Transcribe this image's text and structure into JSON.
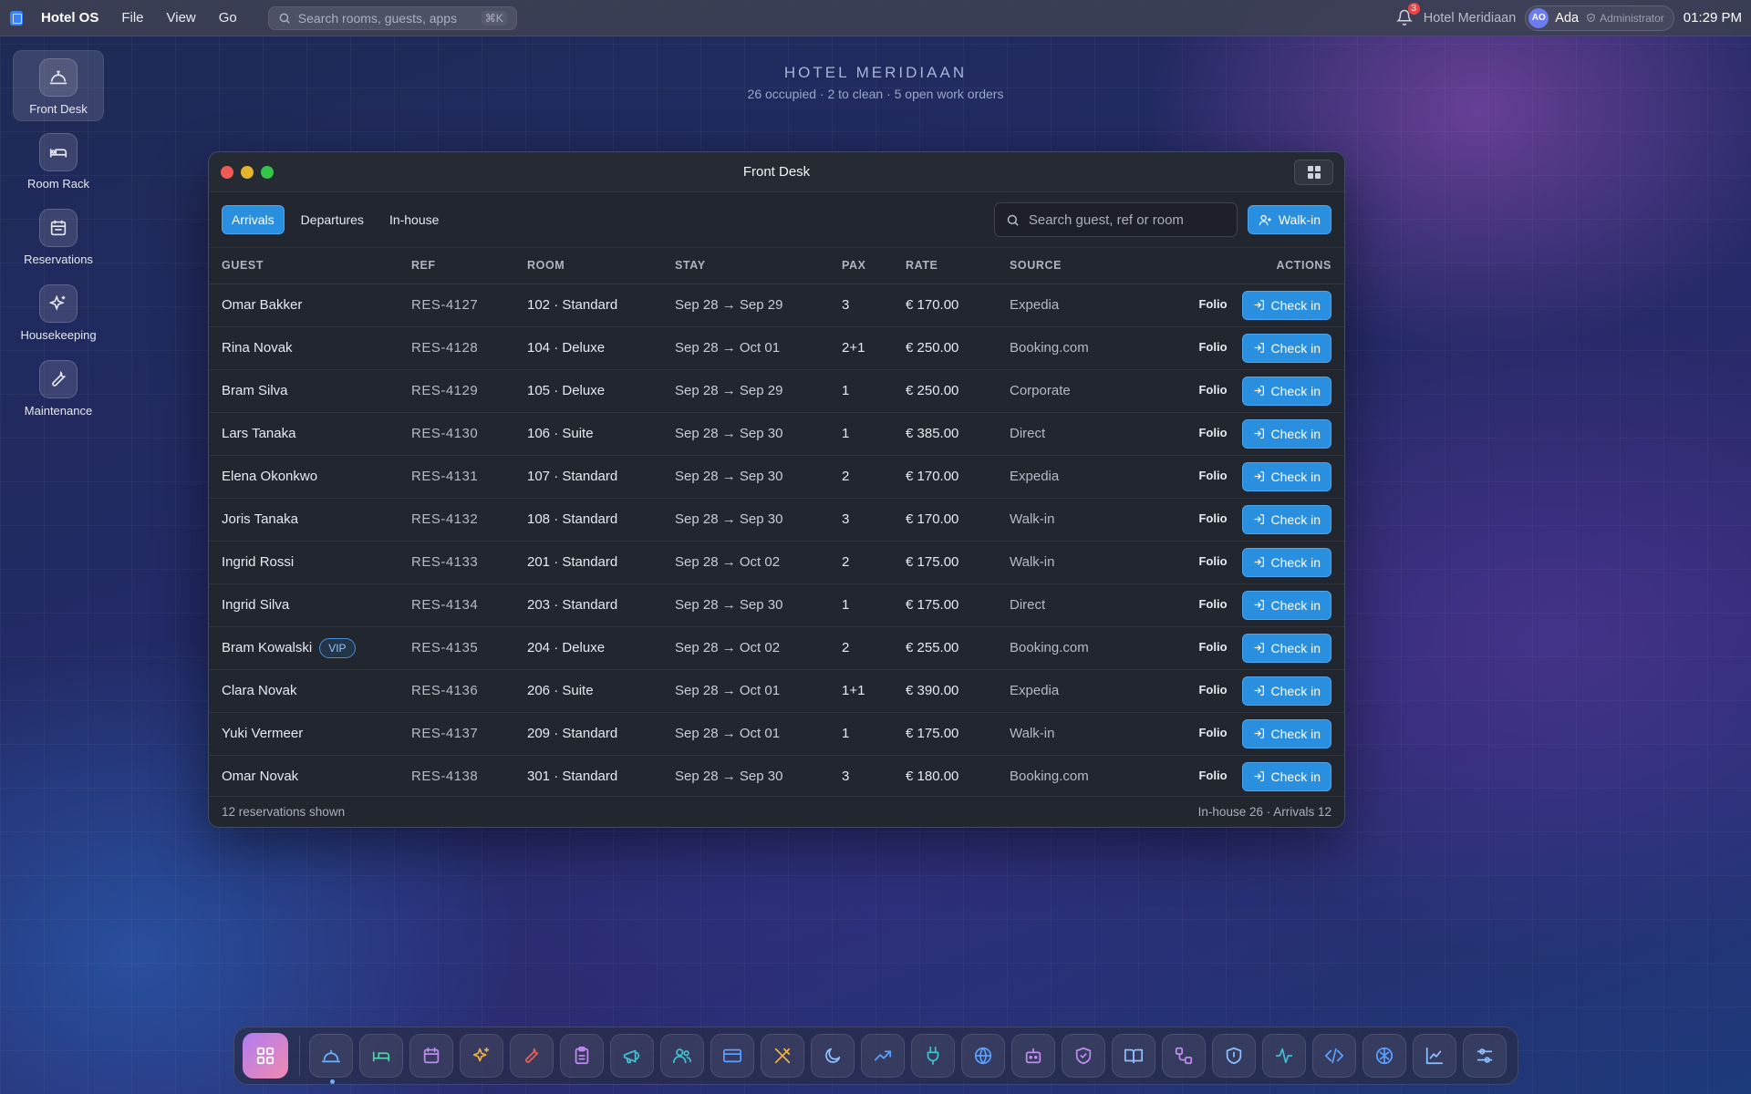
{
  "menubar": {
    "app_name": "Hotel OS",
    "menus": [
      "File",
      "View",
      "Go"
    ],
    "search_placeholder": "Search rooms, guests, apps",
    "search_shortcut": "⌘K",
    "notification_count": "3",
    "hotel_name": "Hotel Meridiaan",
    "user_initials": "AO",
    "user_name": "Ada",
    "user_role": "Administrator",
    "time": "01:29 PM"
  },
  "sidebar": {
    "items": [
      {
        "label": "Front Desk",
        "icon": "bell-desk-icon",
        "active": true
      },
      {
        "label": "Room Rack",
        "icon": "bed-icon",
        "active": false
      },
      {
        "label": "Reservations",
        "icon": "calendar-icon",
        "active": false
      },
      {
        "label": "Housekeeping",
        "icon": "sparkles-icon",
        "active": false
      },
      {
        "label": "Maintenance",
        "icon": "wrench-icon",
        "active": false
      }
    ]
  },
  "header": {
    "title": "HOTEL MERIDIAAN",
    "subtitle": "26 occupied · 2 to clean · 5 open work orders"
  },
  "window": {
    "title": "Front Desk",
    "tabs": [
      {
        "label": "Arrivals",
        "active": true
      },
      {
        "label": "Departures",
        "active": false
      },
      {
        "label": "In-house",
        "active": false
      }
    ],
    "search_placeholder": "Search guest, ref or room",
    "walkin_label": "Walk-in",
    "columns": [
      "GUEST",
      "REF",
      "ROOM",
      "STAY",
      "PAX",
      "RATE",
      "SOURCE",
      "ACTIONS"
    ],
    "rows": [
      {
        "guest": "Omar Bakker",
        "vip": "",
        "ref": "RES-4127",
        "room": "102 · Standard",
        "stay": "Sep 28 → Sep 29",
        "pax": "3",
        "rate": "€ 170.00",
        "source": "Expedia"
      },
      {
        "guest": "Rina Novak",
        "vip": "",
        "ref": "RES-4128",
        "room": "104 · Deluxe",
        "stay": "Sep 28 → Oct 01",
        "pax": "2+1",
        "rate": "€ 250.00",
        "source": "Booking.com"
      },
      {
        "guest": "Bram Silva",
        "vip": "",
        "ref": "RES-4129",
        "room": "105 · Deluxe",
        "stay": "Sep 28 → Sep 29",
        "pax": "1",
        "rate": "€ 250.00",
        "source": "Corporate"
      },
      {
        "guest": "Lars Tanaka",
        "vip": "",
        "ref": "RES-4130",
        "room": "106 · Suite",
        "stay": "Sep 28 → Sep 30",
        "pax": "1",
        "rate": "€ 385.00",
        "source": "Direct"
      },
      {
        "guest": "Elena Okonkwo",
        "vip": "",
        "ref": "RES-4131",
        "room": "107 · Standard",
        "stay": "Sep 28 → Sep 30",
        "pax": "2",
        "rate": "€ 170.00",
        "source": "Expedia"
      },
      {
        "guest": "Joris Tanaka",
        "vip": "",
        "ref": "RES-4132",
        "room": "108 · Standard",
        "stay": "Sep 28 → Sep 30",
        "pax": "3",
        "rate": "€ 170.00",
        "source": "Walk-in"
      },
      {
        "guest": "Ingrid Rossi",
        "vip": "",
        "ref": "RES-4133",
        "room": "201 · Standard",
        "stay": "Sep 28 → Oct 02",
        "pax": "2",
        "rate": "€ 175.00",
        "source": "Walk-in"
      },
      {
        "guest": "Ingrid Silva",
        "vip": "",
        "ref": "RES-4134",
        "room": "203 · Standard",
        "stay": "Sep 28 → Sep 30",
        "pax": "1",
        "rate": "€ 175.00",
        "source": "Direct"
      },
      {
        "guest": "Bram Kowalski",
        "vip": "VIP",
        "ref": "RES-4135",
        "room": "204 · Deluxe",
        "stay": "Sep 28 → Oct 02",
        "pax": "2",
        "rate": "€ 255.00",
        "source": "Booking.com"
      },
      {
        "guest": "Clara Novak",
        "vip": "",
        "ref": "RES-4136",
        "room": "206 · Suite",
        "stay": "Sep 28 → Oct 01",
        "pax": "1+1",
        "rate": "€ 390.00",
        "source": "Expedia"
      },
      {
        "guest": "Yuki Vermeer",
        "vip": "",
        "ref": "RES-4137",
        "room": "209 · Standard",
        "stay": "Sep 28 → Oct 01",
        "pax": "1",
        "rate": "€ 175.00",
        "source": "Walk-in"
      },
      {
        "guest": "Omar Novak",
        "vip": "",
        "ref": "RES-4138",
        "room": "301 · Standard",
        "stay": "Sep 28 → Sep 30",
        "pax": "3",
        "rate": "€ 180.00",
        "source": "Booking.com"
      }
    ],
    "folio_label": "Folio",
    "checkin_label": "Check in",
    "status_left": "12 reservations shown",
    "status_right": "In-house 26 · Arrivals 12"
  },
  "dock": {
    "items": [
      {
        "icon": "bell-desk-icon",
        "color": "#6fb1ff",
        "active": true
      },
      {
        "icon": "bed-icon",
        "color": "#4ad6a0"
      },
      {
        "icon": "calendar-icon",
        "color": "#c08cf0"
      },
      {
        "icon": "sparkles-icon",
        "color": "#f0b040"
      },
      {
        "icon": "wrench-icon",
        "color": "#f06050"
      },
      {
        "icon": "clipboard-icon",
        "color": "#c08cf0"
      },
      {
        "icon": "megaphone-icon",
        "color": "#40c0d0"
      },
      {
        "icon": "users-icon",
        "color": "#40c0d0"
      },
      {
        "icon": "credit-card-icon",
        "color": "#5aa0ff"
      },
      {
        "icon": "utensils-icon",
        "color": "#f0b040"
      },
      {
        "icon": "moon-icon",
        "color": "#8ec0ff"
      },
      {
        "icon": "trend-up-icon",
        "color": "#5aa0ff"
      },
      {
        "icon": "plug-icon",
        "color": "#40c0d0"
      },
      {
        "icon": "globe-icon",
        "color": "#5aa0ff"
      },
      {
        "icon": "bot-icon",
        "color": "#c08cf0"
      },
      {
        "icon": "shield-check-icon",
        "color": "#c08cf0"
      },
      {
        "icon": "book-icon",
        "color": "#8ec0ff"
      },
      {
        "icon": "workflow-icon",
        "color": "#c08cf0"
      },
      {
        "icon": "shield-icon",
        "color": "#8ec0ff"
      },
      {
        "icon": "activity-icon",
        "color": "#40c0d0"
      },
      {
        "icon": "code-icon",
        "color": "#5aa0ff"
      },
      {
        "icon": "brain-icon",
        "color": "#5aa0ff"
      },
      {
        "icon": "line-chart-icon",
        "color": "#8ec0ff"
      },
      {
        "icon": "settings-sliders-icon",
        "color": "#8ec0ff"
      }
    ]
  }
}
